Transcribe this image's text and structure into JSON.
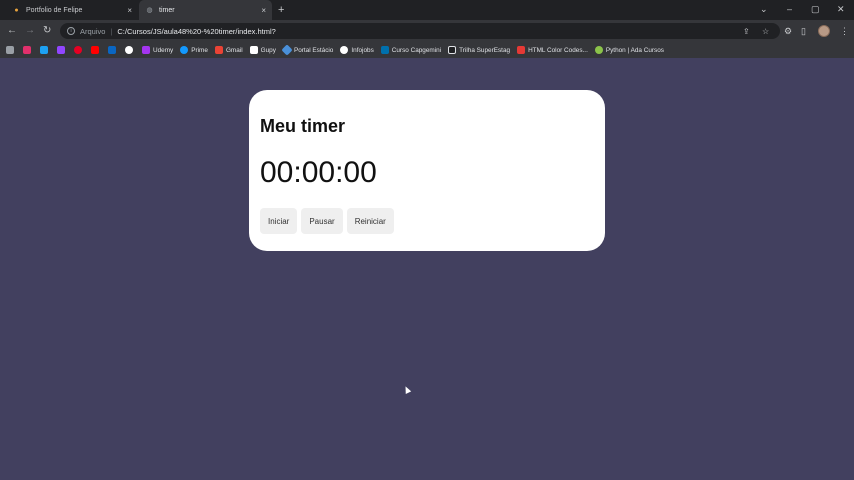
{
  "tabs": [
    {
      "title": "Portfolio de Felipe",
      "close": "×"
    },
    {
      "title": "timer",
      "close": "×"
    }
  ],
  "new_tab": "+",
  "window_controls": {
    "tab_search": "⌄",
    "minimize": "–",
    "restore": "▢",
    "close": "✕"
  },
  "nav": {
    "back": "←",
    "forward": "→",
    "reload": "↻"
  },
  "address": {
    "scheme": "Arquivo",
    "separator": "|",
    "url": "C:/Cursos/JS/aula48%20-%20timer/index.html?"
  },
  "toolbar_icons": {
    "share": "⇪",
    "star": "☆",
    "extensions": "⚙",
    "sidepanel": "▯",
    "menu": "⋮"
  },
  "bookmarks": [
    {
      "label": "",
      "color": "#9aa0a6"
    },
    {
      "label": "",
      "color": "#e1306c"
    },
    {
      "label": "",
      "color": "#1da1f2"
    },
    {
      "label": "",
      "color": "#9146ff"
    },
    {
      "label": "",
      "color": "#e60023"
    },
    {
      "label": "",
      "color": "#ff0000"
    },
    {
      "label": "",
      "color": "#0a66c2"
    },
    {
      "label": "",
      "color": "#ffffff"
    },
    {
      "label": "Udemy",
      "color": "#a435f0"
    },
    {
      "label": "Prime",
      "color": "#1399ff"
    },
    {
      "label": "Gmail",
      "color": "#ea4335"
    },
    {
      "label": "Gupy",
      "color": "#ffffff"
    },
    {
      "label": "Portal Estácio",
      "color": "#4a90d9"
    },
    {
      "label": "Infojobs",
      "color": "#ffffff"
    },
    {
      "label": "Curso Capgemini",
      "color": "#0070ad"
    },
    {
      "label": "Trilha SuperEstag",
      "color": "#202124"
    },
    {
      "label": "HTML Color Codes...",
      "color": "#e53935"
    },
    {
      "label": "Python | Ada Cursos",
      "color": "#8bc34a"
    }
  ],
  "timer": {
    "title": "Meu timer",
    "display": "00:00:00",
    "buttons": {
      "start": "Iniciar",
      "pause": "Pausar",
      "reset": "Reiniciar"
    }
  }
}
